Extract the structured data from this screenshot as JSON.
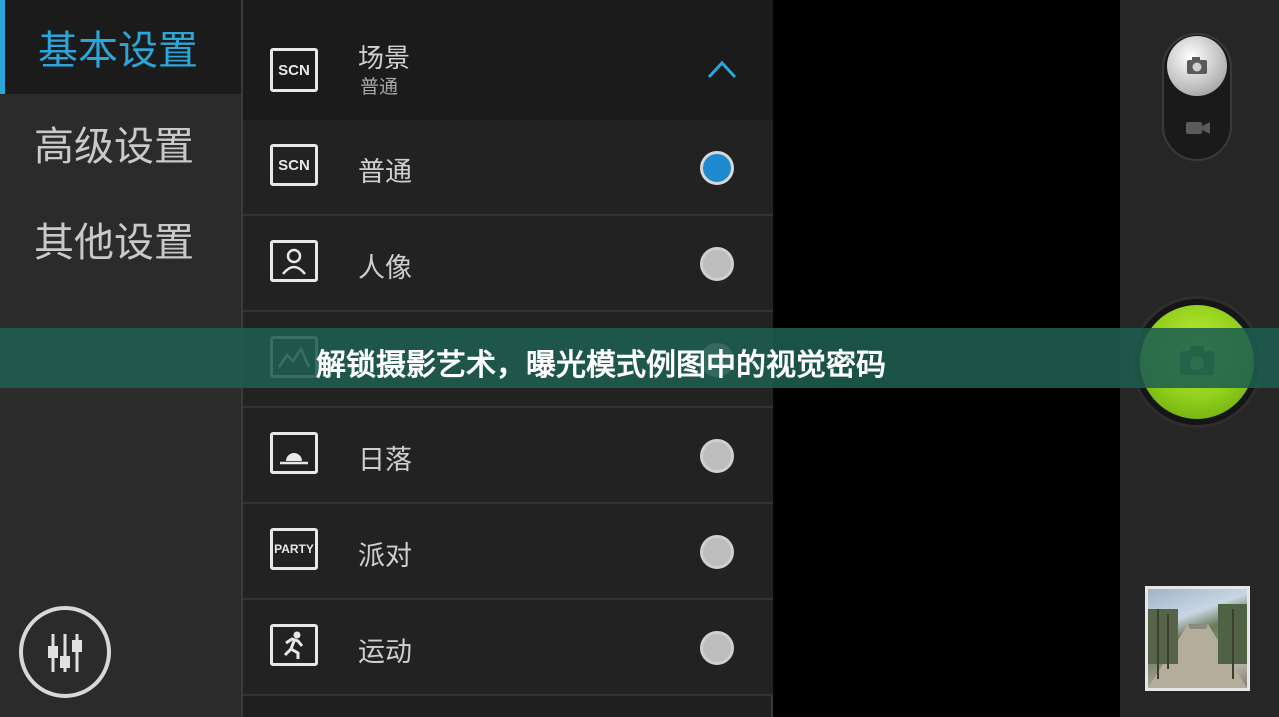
{
  "sidebar": {
    "items": [
      {
        "label": "基本设置",
        "active": true
      },
      {
        "label": "高级设置",
        "active": false
      },
      {
        "label": "其他设置",
        "active": false
      }
    ],
    "equalizer_icon": "sliders-icon"
  },
  "scene_panel": {
    "header": {
      "title": "场景",
      "value": "普通",
      "icon_text": "SCN"
    },
    "options": [
      {
        "label": "普通",
        "icon": "SCN",
        "selected": true
      },
      {
        "label": "人像",
        "icon": "portrait-icon",
        "selected": false
      },
      {
        "label": "",
        "icon": "landscape-icon",
        "selected": false
      },
      {
        "label": "日落",
        "icon": "sunset-icon",
        "selected": false
      },
      {
        "label": "派对",
        "icon": "PARTY",
        "selected": false
      },
      {
        "label": "运动",
        "icon": "sports-runner-icon",
        "selected": false
      }
    ]
  },
  "camera_controls": {
    "photo_mode_icon": "camera-icon",
    "video_mode_icon": "video-icon",
    "shutter_icon": "camera-icon",
    "gallery_thumbnail": "gallery-thumbnail"
  },
  "banner": {
    "text": "解锁摄影艺术，曝光模式例图中的视觉密码"
  },
  "colors": {
    "accent": "#2ca6d8",
    "radio_selected": "#1e8bd0",
    "shutter": "#9ad21f",
    "banner": "#1e5f50"
  }
}
